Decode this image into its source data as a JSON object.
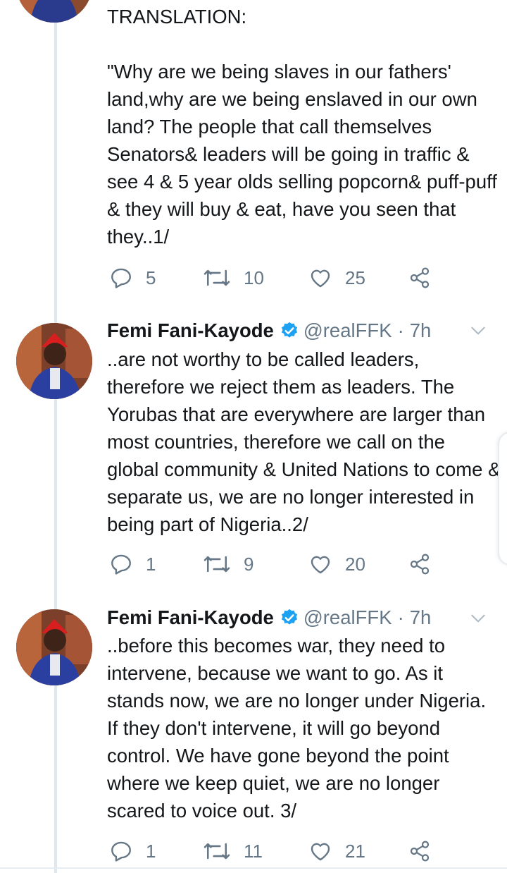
{
  "tweets": [
    {
      "text": "TRANSLATION:\n\n\"Why are we being slaves in our fathers' land,why are we being enslaved in our own land? The people that call themselves Senators& leaders will be going in traffic & see 4 & 5 year olds selling popcorn& puff-puff & they will buy & eat, have you seen that they..1/",
      "replies": "5",
      "retweets": "10",
      "likes": "25"
    },
    {
      "name": "Femi Fani-Kayode",
      "handle": "@realFFK",
      "sep": "·",
      "time": "7h",
      "text": "..are not worthy to be called leaders, therefore we reject them as leaders. The Yorubas that are everywhere are larger than most countries, therefore we call on the global community & United Nations to come & separate us, we are no longer interested in being part of Nigeria..2/",
      "replies": "1",
      "retweets": "9",
      "likes": "20"
    },
    {
      "name": "Femi Fani-Kayode",
      "handle": "@realFFK",
      "sep": "·",
      "time": "7h",
      "text": "..before this becomes war, they need to intervene, because we want to go. As it stands now, we are no longer under Nigeria. If they don't intervene, it will go beyond control. We have gone beyond the point where we keep quiet, we are no longer scared to voice out. 3/",
      "replies": "1",
      "retweets": "11",
      "likes": "21"
    }
  ],
  "icons": {
    "reply": "reply-icon",
    "retweet": "retweet-icon",
    "like": "like-icon",
    "share": "share-icon",
    "verified": "verified-icon",
    "caret": "chevron-down-icon"
  },
  "colors": {
    "text": "#14171a",
    "muted": "#657786",
    "verified": "#1da1f2",
    "divider": "#e6ecf0"
  }
}
